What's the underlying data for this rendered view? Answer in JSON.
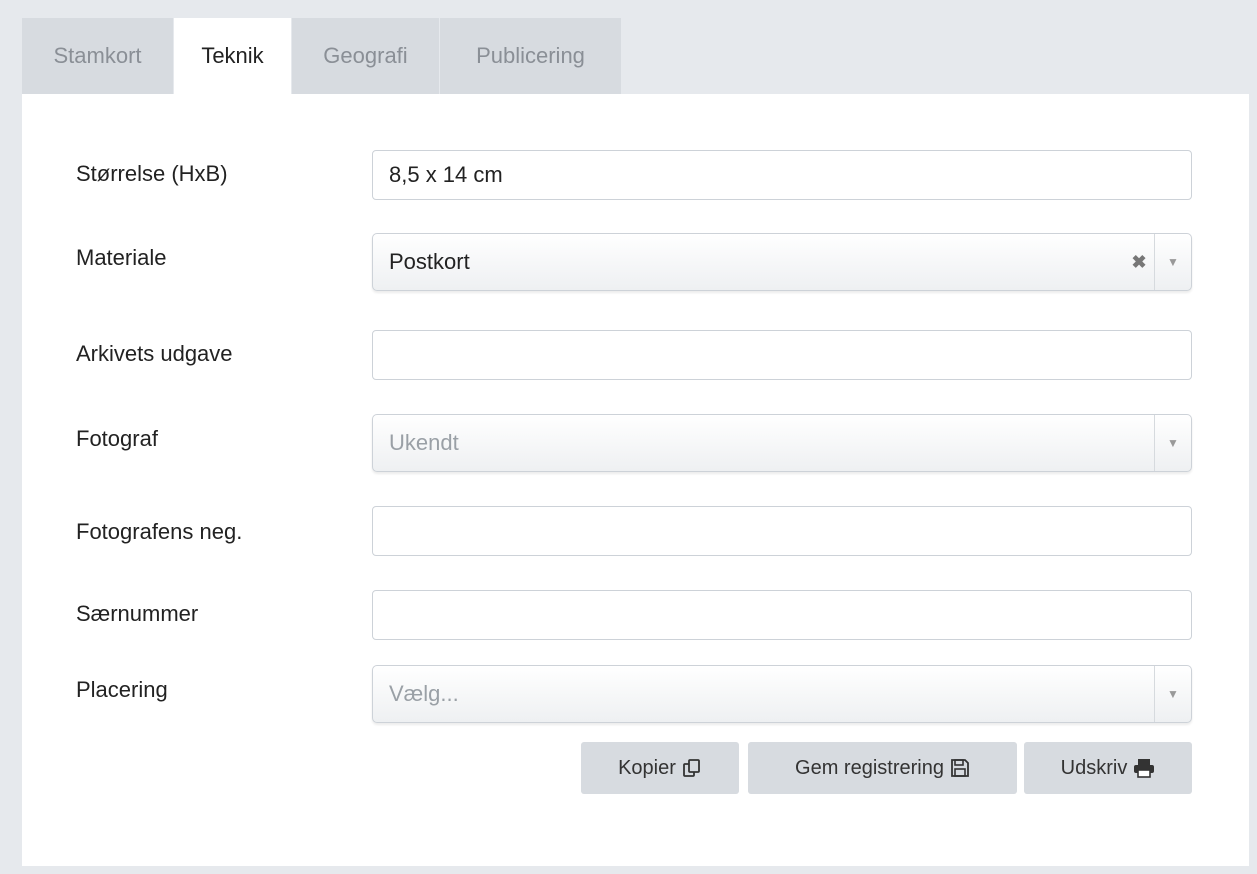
{
  "tabs": [
    {
      "label": "Stamkort",
      "active": false
    },
    {
      "label": "Teknik",
      "active": true
    },
    {
      "label": "Geografi",
      "active": false
    },
    {
      "label": "Publicering",
      "active": false
    }
  ],
  "form": {
    "size": {
      "label": "Størrelse (HxB)",
      "value": "8,5 x 14 cm"
    },
    "material": {
      "label": "Materiale",
      "value": "Postkort"
    },
    "archive_edition": {
      "label": "Arkivets udgave",
      "value": ""
    },
    "photographer": {
      "label": "Fotograf",
      "placeholder": "Ukendt"
    },
    "photographer_neg": {
      "label": "Fotografens neg.",
      "value": ""
    },
    "special_number": {
      "label": "Særnummer",
      "value": ""
    },
    "placement": {
      "label": "Placering",
      "placeholder": "Vælg..."
    }
  },
  "buttons": {
    "copy": "Kopier",
    "save": "Gem registrering",
    "print": "Udskriv"
  },
  "icons": {
    "copy": "copy-icon",
    "save": "floppy-disk-icon",
    "print": "printer-icon",
    "clear": "clear-x-icon",
    "dropdown": "caret-down-icon"
  },
  "colors": {
    "background": "#e6e9ed",
    "tab_inactive": "#d7dbe0",
    "button": "#d7dbe0"
  }
}
